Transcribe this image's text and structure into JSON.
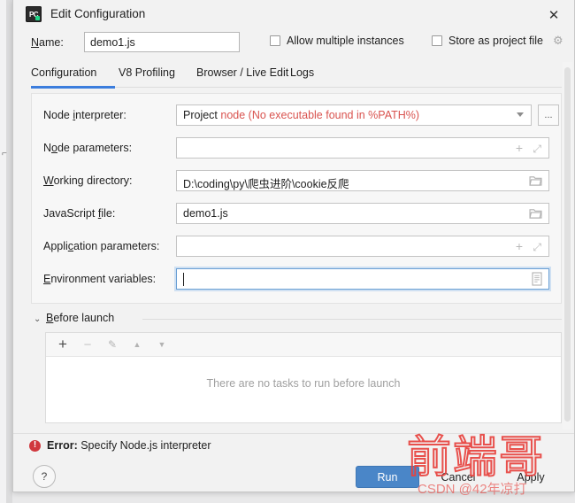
{
  "window": {
    "title": "Edit Configuration",
    "app_icon": "pycharm-icon",
    "close_icon": "✕"
  },
  "name_row": {
    "label": "Name:",
    "value": "demo1.js",
    "allow_multiple_instances": "Allow multiple instances",
    "store_as_project_file": "Store as project file",
    "gear_icon": "⚙"
  },
  "tabs": [
    {
      "label": "Configuration",
      "active": true
    },
    {
      "label": "V8 Profiling",
      "active": false
    },
    {
      "label": "Browser / Live Edit",
      "active": false
    },
    {
      "label": "Logs",
      "active": false
    }
  ],
  "form": {
    "node_interpreter": {
      "label": "Node interpreter:",
      "value_prefix": "Project",
      "value_error": "node (No executable found in %PATH%)",
      "browse_label": "...",
      "dropdown_icon": "chevron-down-icon"
    },
    "node_parameters": {
      "label": "Node parameters:",
      "value": "",
      "add_icon": "+",
      "expand_icon": "⤢"
    },
    "working_directory": {
      "label": "Working directory:",
      "value": "D:\\coding\\py\\爬虫进阶\\cookie反爬",
      "folder_icon": "folder-icon"
    },
    "javascript_file": {
      "label": "JavaScript file:",
      "value": "demo1.js",
      "folder_icon": "folder-icon"
    },
    "application_parameters": {
      "label": "Application parameters:",
      "value": "",
      "add_icon": "+",
      "expand_icon": "⤢"
    },
    "environment_variables": {
      "label": "Environment variables:",
      "value": "",
      "focused": true,
      "list_icon": "list-icon"
    }
  },
  "before_launch": {
    "title": "Before launch",
    "chevron": "⌄",
    "toolbar": {
      "add": "+",
      "remove": "−",
      "edit": "✎",
      "move_up": "▲",
      "move_down": "▼"
    },
    "empty_message": "There are no tasks to run before launch"
  },
  "error": {
    "icon": "!",
    "prefix": "Error:",
    "message": "Specify Node.js interpreter",
    "color": "#d0383e"
  },
  "footer": {
    "help": "?",
    "run": "Run",
    "cancel": "Cancel",
    "apply": "Apply",
    "run_color": "#4a86c8"
  },
  "watermark": {
    "main": "前端哥",
    "sub": "CSDN @42年凉打",
    "color": "#e8433f"
  }
}
